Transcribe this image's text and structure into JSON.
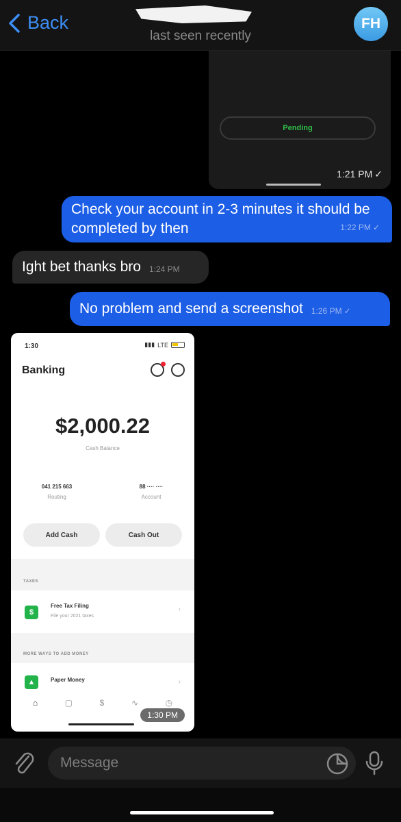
{
  "header": {
    "back_label": "Back",
    "status": "last seen recently",
    "avatar_initials": "FH"
  },
  "messages": {
    "media_top": {
      "pill_text": "Pending",
      "time": "1:21 PM"
    },
    "out1": {
      "text": "Check your account in 2-3 minutes it should be completed by then",
      "time": "1:22 PM"
    },
    "in1": {
      "text": "Ight bet thanks bro",
      "time": "1:24 PM"
    },
    "out2": {
      "text": "No problem and send a screenshot",
      "time": "1:26 PM"
    }
  },
  "screenshot_card": {
    "status_time": "1:30",
    "network": "LTE",
    "title": "Banking",
    "balance": "$2,000.22",
    "balance_label": "Cash Balance",
    "routing_value": "041 215 663",
    "routing_label": "Routing",
    "account_value": "88 ···· ····",
    "account_label": "Account",
    "add_cash_label": "Add Cash",
    "cash_out_label": "Cash Out",
    "taxes_section": "TAXES",
    "tax_title": "Free Tax Filing",
    "tax_sub": "File your 2021 taxes",
    "more_section": "MORE WAYS TO ADD MONEY",
    "paper_money": "Paper Money",
    "time_chip": "1:30 PM"
  },
  "input": {
    "placeholder": "Message"
  },
  "colors": {
    "accent": "#3d8ef5",
    "outgoing_bubble": "#1d5ee6",
    "incoming_bubble": "#262626",
    "pending_green": "#2fbf4a"
  }
}
